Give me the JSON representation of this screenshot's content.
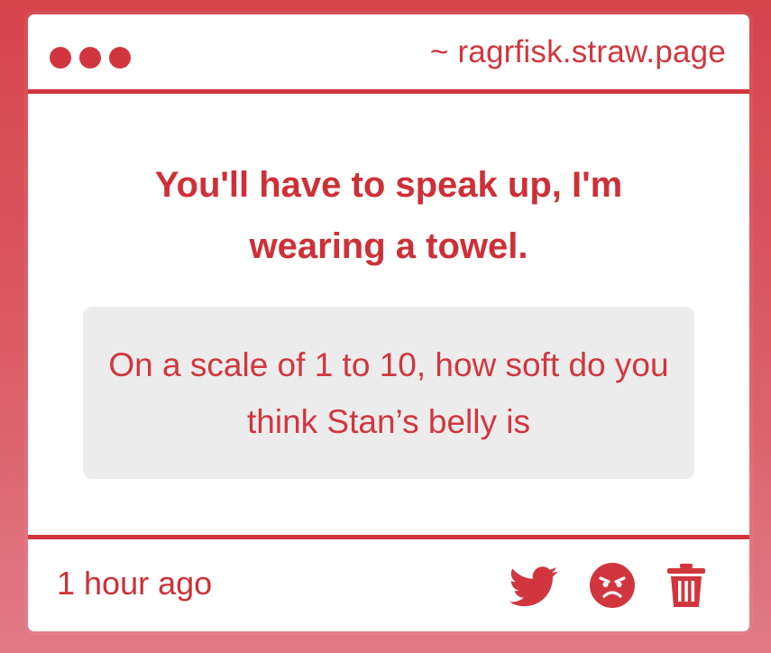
{
  "window": {
    "url": "~ ragrfisk.straw.page",
    "dot_color": "#d1363e"
  },
  "post": {
    "headline": "You'll have to speak up, I'm wearing a towel.",
    "question": "On a scale of 1 to 10, how soft do you think Stan’s belly is"
  },
  "footer": {
    "timestamp": "1 hour ago",
    "icons": [
      "twitter-icon",
      "angry-face-icon",
      "trash-icon"
    ]
  },
  "colors": {
    "accent": "#d1363e",
    "question_bg": "#ececec"
  }
}
